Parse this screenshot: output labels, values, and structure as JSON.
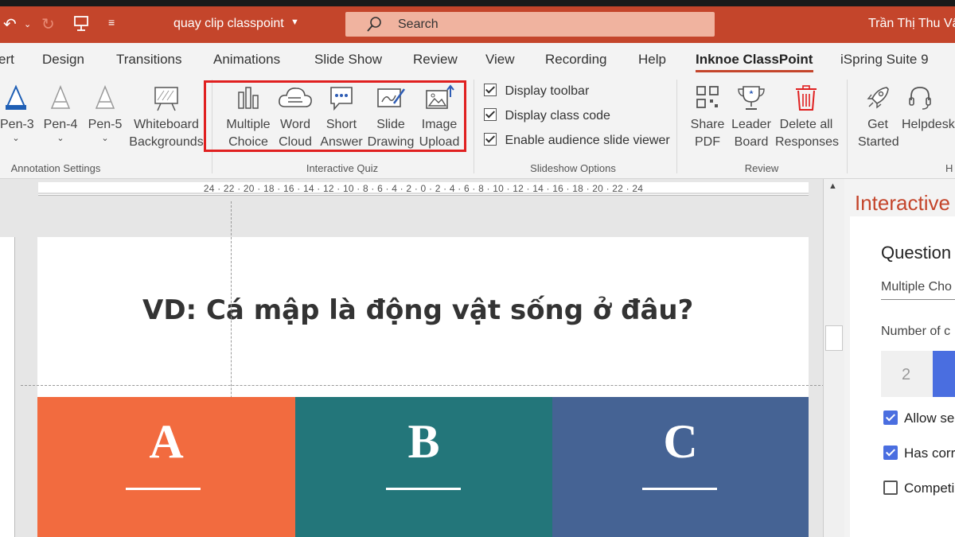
{
  "titlebar": {
    "document_title": "quay clip classpoint",
    "search_placeholder": "Search",
    "user_name": "Trần Thị Thu Vân"
  },
  "tabs": [
    {
      "label": "ert"
    },
    {
      "label": "Design"
    },
    {
      "label": "Transitions"
    },
    {
      "label": "Animations"
    },
    {
      "label": "Slide Show"
    },
    {
      "label": "Review"
    },
    {
      "label": "View"
    },
    {
      "label": "Recording"
    },
    {
      "label": "Help"
    },
    {
      "label": "Inknoe ClassPoint",
      "active": true
    },
    {
      "label": "iSpring Suite 9"
    }
  ],
  "ribbon": {
    "annotation": {
      "group_label": "Annotation Settings",
      "pen3": "Pen-3",
      "pen4": "Pen-4",
      "pen5": "Pen-5",
      "whiteboard_line1": "Whiteboard",
      "whiteboard_line2": "Backgrounds"
    },
    "quiz": {
      "group_label": "Interactive Quiz",
      "multiple_line1": "Multiple",
      "multiple_line2": "Choice",
      "word_line1": "Word",
      "word_line2": "Cloud",
      "short_line1": "Short",
      "short_line2": "Answer",
      "slide_line1": "Slide",
      "slide_line2": "Drawing",
      "image_line1": "Image",
      "image_line2": "Upload"
    },
    "slideshow": {
      "group_label": "Slideshow Options",
      "display_toolbar": "Display toolbar",
      "display_class_code": "Display class code",
      "enable_viewer": "Enable audience slide viewer"
    },
    "review": {
      "group_label": "Review",
      "share_line1": "Share",
      "share_line2": "PDF",
      "leader_line1": "Leader",
      "leader_line2": "Board",
      "delete_line1": "Delete all",
      "delete_line2": "Responses"
    },
    "help": {
      "group_label": "H",
      "get_line1": "Get",
      "get_line2": "Started",
      "helpdesk": "Helpdesk"
    }
  },
  "ruler_labels": "24 · 22 · 20 · 18 · 16 · 14 · 12 · 10 · 8 · 6 · 4 · 2 · 0 · 2 · 4 · 6 · 8 · 10 · 12 · 14 · 16 · 18 · 20 · 22 · 24",
  "slide": {
    "question": "VD: Cá mập là động vật sống ở đâu?",
    "options": [
      {
        "letter": "A",
        "color": "#f26b3f"
      },
      {
        "letter": "B",
        "color": "#23767a"
      },
      {
        "letter": "C",
        "color": "#456394"
      }
    ]
  },
  "panel": {
    "title": "Interactive",
    "question_heading": "Question",
    "question_type": "Multiple Cho",
    "number_label": "Number of c",
    "number_value": "2",
    "allow_label": "Allow se",
    "has_correct_label": "Has corr",
    "competition_label": "Competi"
  }
}
